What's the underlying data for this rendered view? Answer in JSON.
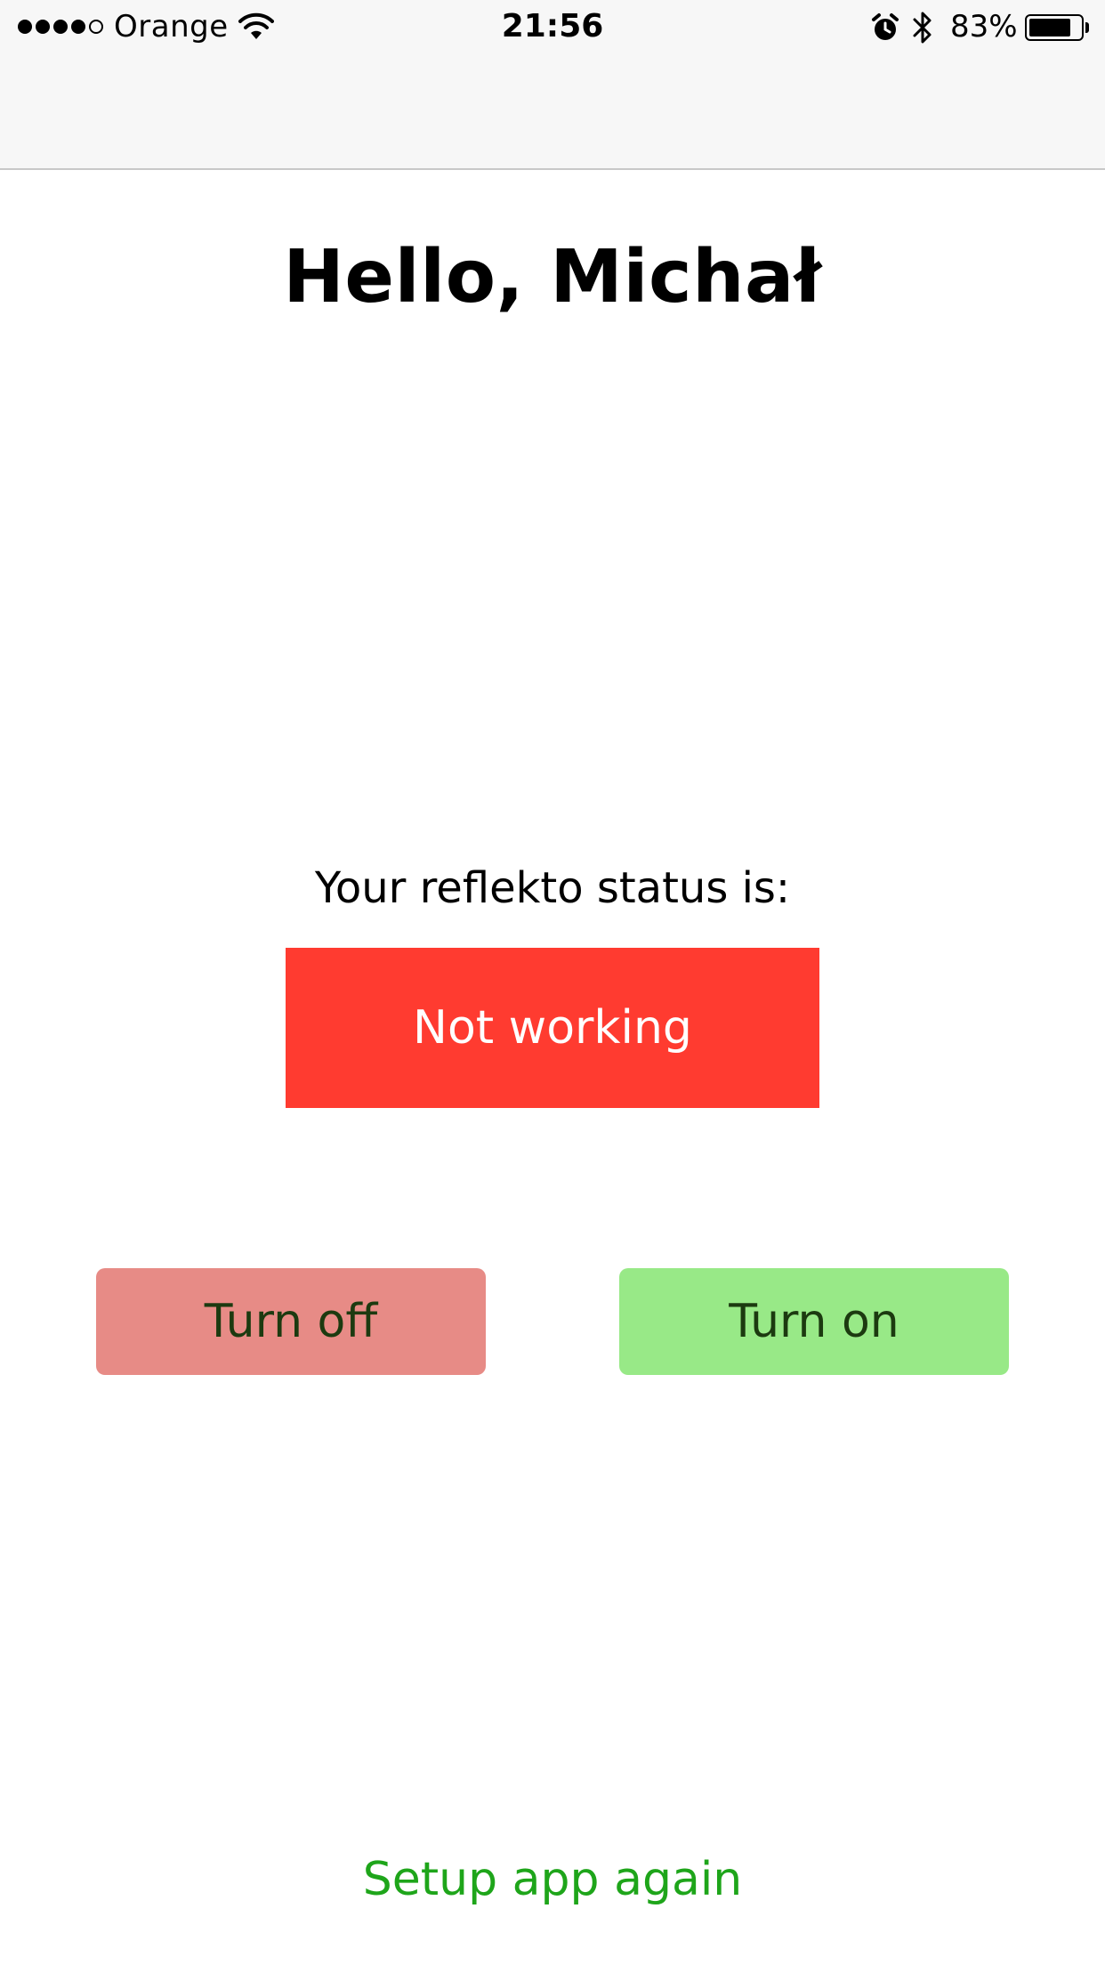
{
  "status_bar": {
    "carrier": "Orange",
    "signal_bars_filled": 4,
    "signal_bars_total": 5,
    "time": "21:56",
    "battery_percent": "83%",
    "battery_level": 0.83
  },
  "main": {
    "greeting": "Hello, Michał",
    "status_label": "Your reflekto status is:",
    "status_value": "Not working",
    "status_color": "#ff3b30"
  },
  "actions": {
    "turn_off_label": "Turn off",
    "turn_off_color": "#e78b86",
    "turn_on_label": "Turn on",
    "turn_on_color": "#98e987"
  },
  "footer": {
    "setup_link": "Setup app again",
    "setup_link_color": "#1ea51a"
  },
  "icons": [
    "signal-icon",
    "wifi-icon",
    "alarm-icon",
    "bluetooth-icon",
    "battery-icon"
  ]
}
